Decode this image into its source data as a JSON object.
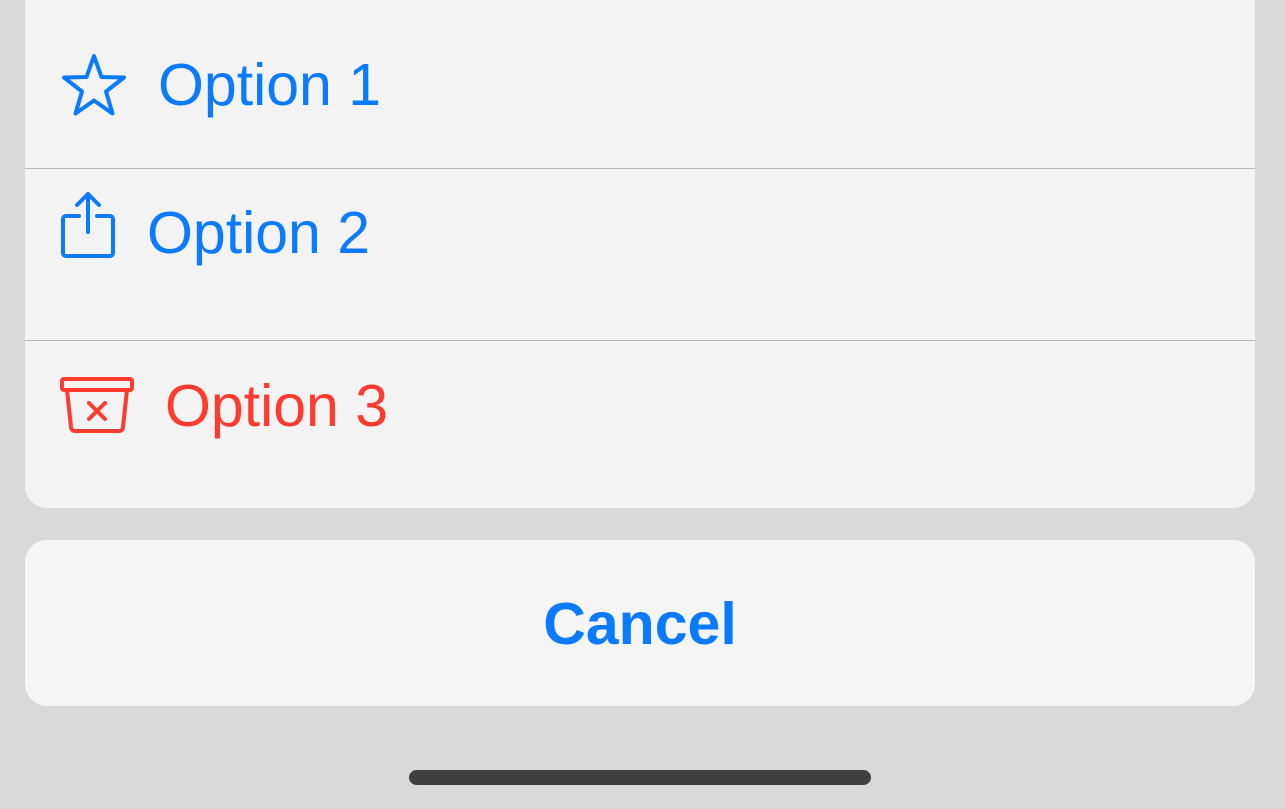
{
  "action_sheet": {
    "options": [
      {
        "label": "Option 1",
        "icon": "star-icon",
        "color": "#0a7aff"
      },
      {
        "label": "Option 2",
        "icon": "share-icon",
        "color": "#0a7aff"
      },
      {
        "label": "Option 3",
        "icon": "delete-bin-icon",
        "color": "#ff3b30"
      }
    ],
    "cancel_label": "Cancel"
  },
  "colors": {
    "accent": "#0a7aff",
    "destructive": "#ff3b30",
    "backdrop": "#d9d9d9",
    "sheet": "#f3f3f3"
  }
}
